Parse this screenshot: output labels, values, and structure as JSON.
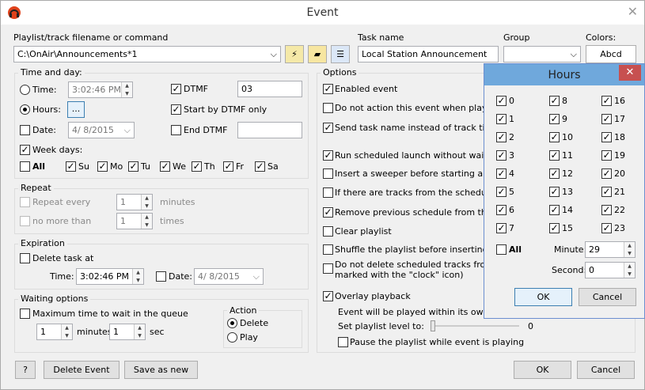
{
  "window": {
    "title": "Event"
  },
  "playlist": {
    "label": "Playlist/track filename or command",
    "value": "C:\\OnAir\\Announcements*1"
  },
  "task": {
    "label": "Task name",
    "value": "Local Station Announcement"
  },
  "group": {
    "label": "Group",
    "value": ""
  },
  "colors": {
    "label": "Colors:",
    "sample": "Abcd"
  },
  "timeday": {
    "label": "Time and day:",
    "time_label": "Time:",
    "time_value": "3:02:46 PM",
    "hours_label": "Hours:",
    "hours_btn": "...",
    "date_label": "Date:",
    "date_value": "4/ 8/2015",
    "dtmf_label": "DTMF",
    "dtmf_value": "03",
    "start_dtmf_label": "Start by DTMF only",
    "end_dtmf_label": "End DTMF",
    "end_dtmf_value": "",
    "weekdays_label": "Week days:",
    "all_label": "All",
    "days": [
      "Su",
      "Mo",
      "Tu",
      "We",
      "Th",
      "Fr",
      "Sa"
    ]
  },
  "repeat": {
    "label": "Repeat",
    "every_label": "Repeat every",
    "every_value": "1",
    "minutes": "minutes",
    "nomore_label": "no more than",
    "nomore_value": "1",
    "times": "times"
  },
  "expiration": {
    "label": "Expiration",
    "delete_label": "Delete task at",
    "time_label": "Time:",
    "time_value": "3:02:46 PM",
    "date_label": "Date:",
    "date_value": "4/ 8/2015"
  },
  "waiting": {
    "label": "Waiting options",
    "max_label": "Maximum time to wait in the queue",
    "min_value": "1",
    "minutes": "minutes",
    "sec_value": "1",
    "sec": "sec"
  },
  "action": {
    "label": "Action",
    "delete": "Delete",
    "play": "Play"
  },
  "options": {
    "label": "Options",
    "items": [
      "Enabled event",
      "Do not action this event when playlist is",
      "Send task name instead of track titles to",
      "Run scheduled launch without waiting fo",
      "Insert a sweeper before starting an eve",
      "If there are tracks from the schedule in",
      "Remove previous schedule from the pla",
      "Clear playlist",
      "Shuffle the playlist before inserting",
      "Do not delete scheduled tracks from pla"
    ],
    "item_extra": "marked with the \"clock\" icon)",
    "overlay_label": "Overlay playback",
    "overlay_note": "Event will be played within its own playl",
    "level_label": "Set playlist level to:",
    "level_value": "0",
    "pause_label": "Pause the playlist while event is playing"
  },
  "footer": {
    "help": "?",
    "delete_event": "Delete Event",
    "save_as_new": "Save as new",
    "ok": "OK",
    "cancel": "Cancel"
  },
  "hours_dialog": {
    "title": "Hours",
    "all_label": "All",
    "minute_label": "Minute:",
    "minute_value": "29",
    "second_label": "Second:",
    "second_value": "0",
    "ok": "OK",
    "cancel": "Cancel",
    "hours": [
      "0",
      "1",
      "2",
      "3",
      "4",
      "5",
      "6",
      "7",
      "8",
      "9",
      "10",
      "11",
      "12",
      "13",
      "14",
      "15",
      "16",
      "17",
      "18",
      "19",
      "20",
      "21",
      "22",
      "23"
    ]
  }
}
